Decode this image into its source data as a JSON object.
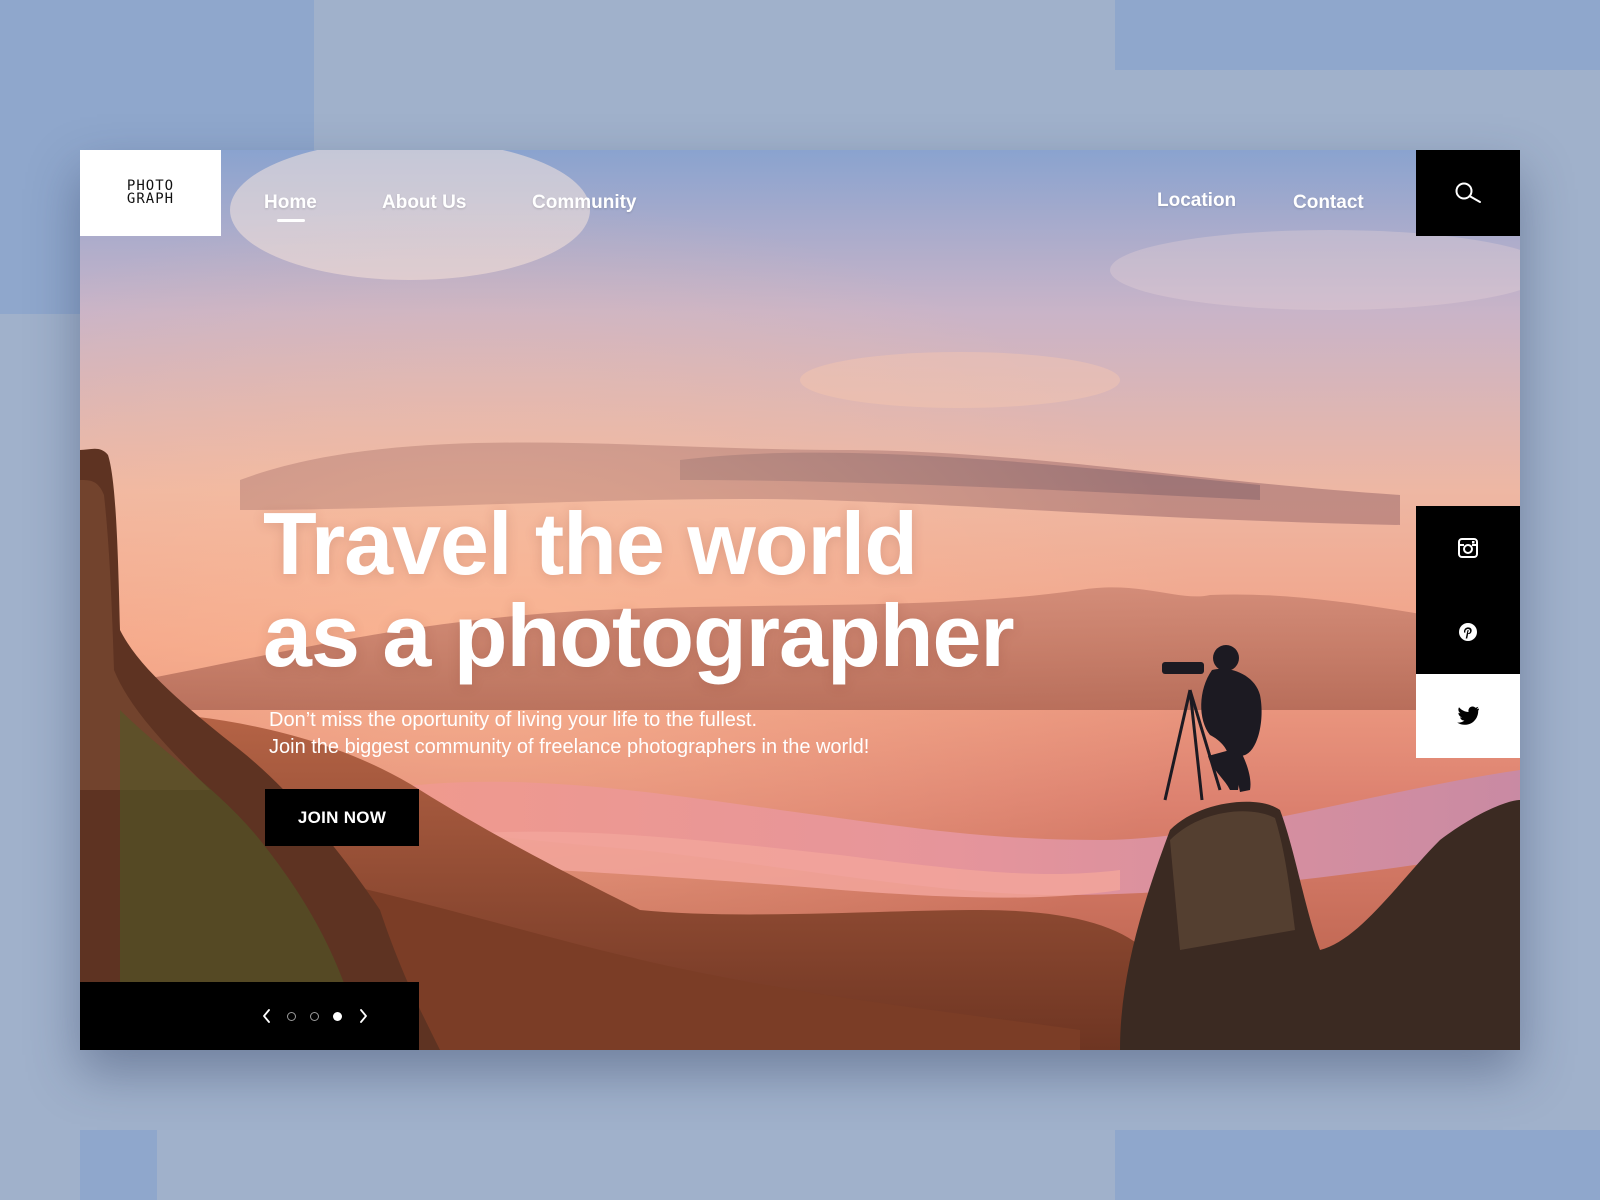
{
  "logo": {
    "line1": "PHOTO",
    "line2": "GRAPH"
  },
  "nav": {
    "left": [
      {
        "label": "Home",
        "active": true
      },
      {
        "label": "About Us",
        "active": false
      },
      {
        "label": "Community",
        "active": false
      }
    ],
    "right": [
      {
        "label": "Location"
      },
      {
        "label": "Contact"
      }
    ]
  },
  "search": {
    "icon": "search-icon"
  },
  "hero": {
    "headline_line1": "Travel the world",
    "headline_line2": "as a photographer",
    "sub_line1": "Don’t miss the oportunity of living your life to the fullest.",
    "sub_line2": "Join the biggest community of freelance photographers in the world!",
    "cta_label": "JOIN NOW"
  },
  "slider": {
    "prev_icon": "chevron-left-icon",
    "next_icon": "chevron-right-icon",
    "slide_count": 3,
    "active_slide": 3
  },
  "social": [
    {
      "name": "instagram-icon",
      "theme": "dark"
    },
    {
      "name": "pinterest-icon",
      "theme": "dark"
    },
    {
      "name": "twitter-icon",
      "theme": "light"
    }
  ],
  "colors": {
    "page_background": "#a0b1cb",
    "accent_blocks": "#8fa7cc",
    "black_panels": "#000000",
    "text_light": "#ffffff"
  }
}
